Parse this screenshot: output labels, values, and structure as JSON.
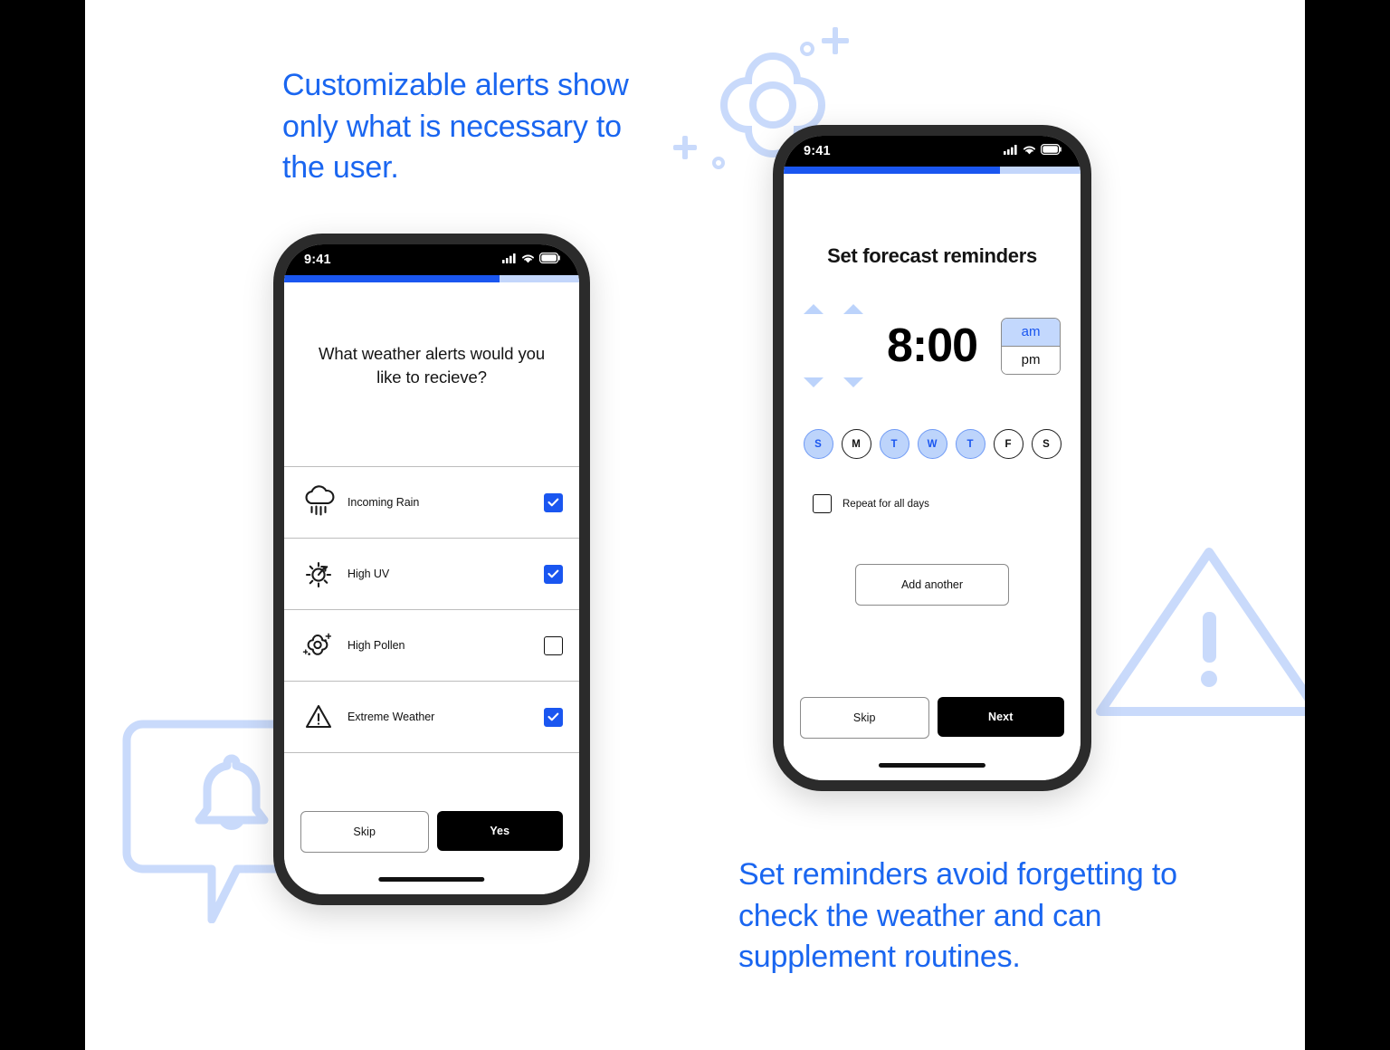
{
  "captions": {
    "left": "Customizable alerts show only what is necessary to the user.",
    "right": "Set reminders avoid forgetting to check the weather and can supplement routines."
  },
  "colors": {
    "accent_blue": "#1a56f0",
    "caption_blue": "#1a66f0",
    "light_blue": "#c3d6fb",
    "deco_blue": "#c9dafb",
    "dark_button": "#000000"
  },
  "phone_left": {
    "status_bar": {
      "time": "9:41",
      "icons": [
        "signal-icon",
        "wifi-icon",
        "battery-icon"
      ]
    },
    "progress_percent": 73,
    "question": "What weather alerts would you like to recieve?",
    "alerts": [
      {
        "icon": "rain-cloud-icon",
        "label": "Incoming Rain",
        "checked": true
      },
      {
        "icon": "sun-uv-icon",
        "label": "High UV",
        "checked": true
      },
      {
        "icon": "pollen-flower-icon",
        "label": "High Pollen",
        "checked": false
      },
      {
        "icon": "warning-triangle-icon",
        "label": "Extreme Weather",
        "checked": true
      }
    ],
    "buttons": {
      "secondary": "Skip",
      "primary": "Yes"
    }
  },
  "phone_right": {
    "status_bar": {
      "time": "9:41",
      "icons": [
        "signal-icon",
        "wifi-icon",
        "battery-icon"
      ]
    },
    "progress_percent": 73,
    "title": "Set forecast reminders",
    "time_picker": {
      "hour": "8",
      "separator": ":",
      "minute": "00",
      "display": "8:00",
      "meridiem_options": [
        "am",
        "pm"
      ],
      "meridiem_selected": "am"
    },
    "days": [
      {
        "label": "S",
        "selected": true
      },
      {
        "label": "M",
        "selected": false
      },
      {
        "label": "T",
        "selected": true
      },
      {
        "label": "W",
        "selected": true
      },
      {
        "label": "T",
        "selected": true
      },
      {
        "label": "F",
        "selected": false
      },
      {
        "label": "S",
        "selected": false
      }
    ],
    "repeat": {
      "label": "Repeat for all days",
      "checked": false
    },
    "add_another": "Add another",
    "buttons": {
      "secondary": "Skip",
      "primary": "Next"
    }
  },
  "decorations": [
    {
      "name": "pollen-flower-decoration"
    },
    {
      "name": "notification-bell-bubble-decoration"
    },
    {
      "name": "warning-triangle-decoration"
    }
  ]
}
